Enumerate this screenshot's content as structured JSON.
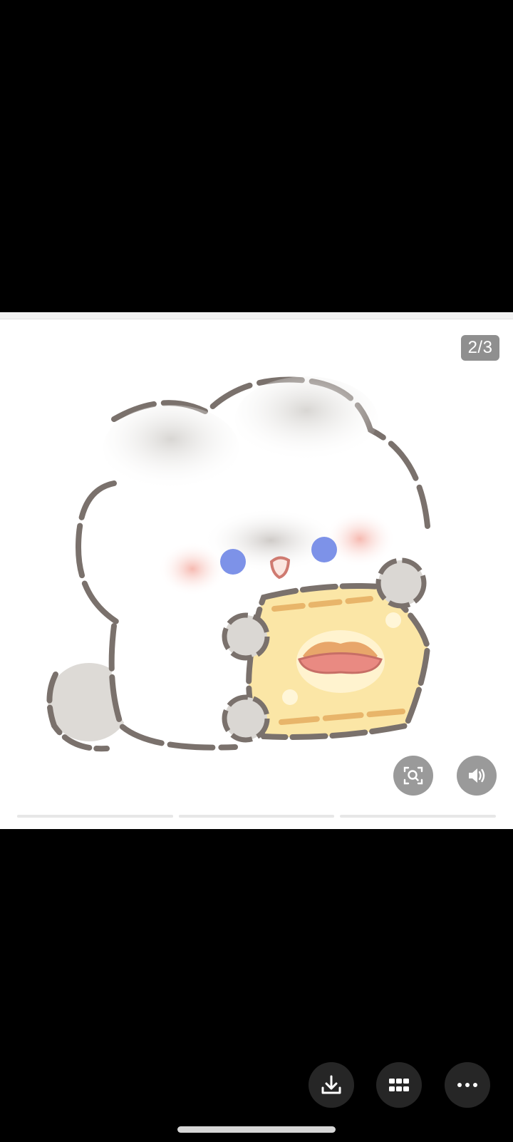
{
  "viewer": {
    "page_counter": "2/3",
    "slide_progress": {
      "current": 2,
      "total": 3
    }
  },
  "icons": {
    "scan": "image-search-icon",
    "sound": "speaker-icon",
    "download": "download-icon",
    "grid": "grid-icon",
    "more": "more-dots-icon"
  },
  "colors": {
    "background": "#000000",
    "frame": "#ffffff",
    "button_overlay": "#9a9a9a",
    "action_button": "#262626"
  }
}
